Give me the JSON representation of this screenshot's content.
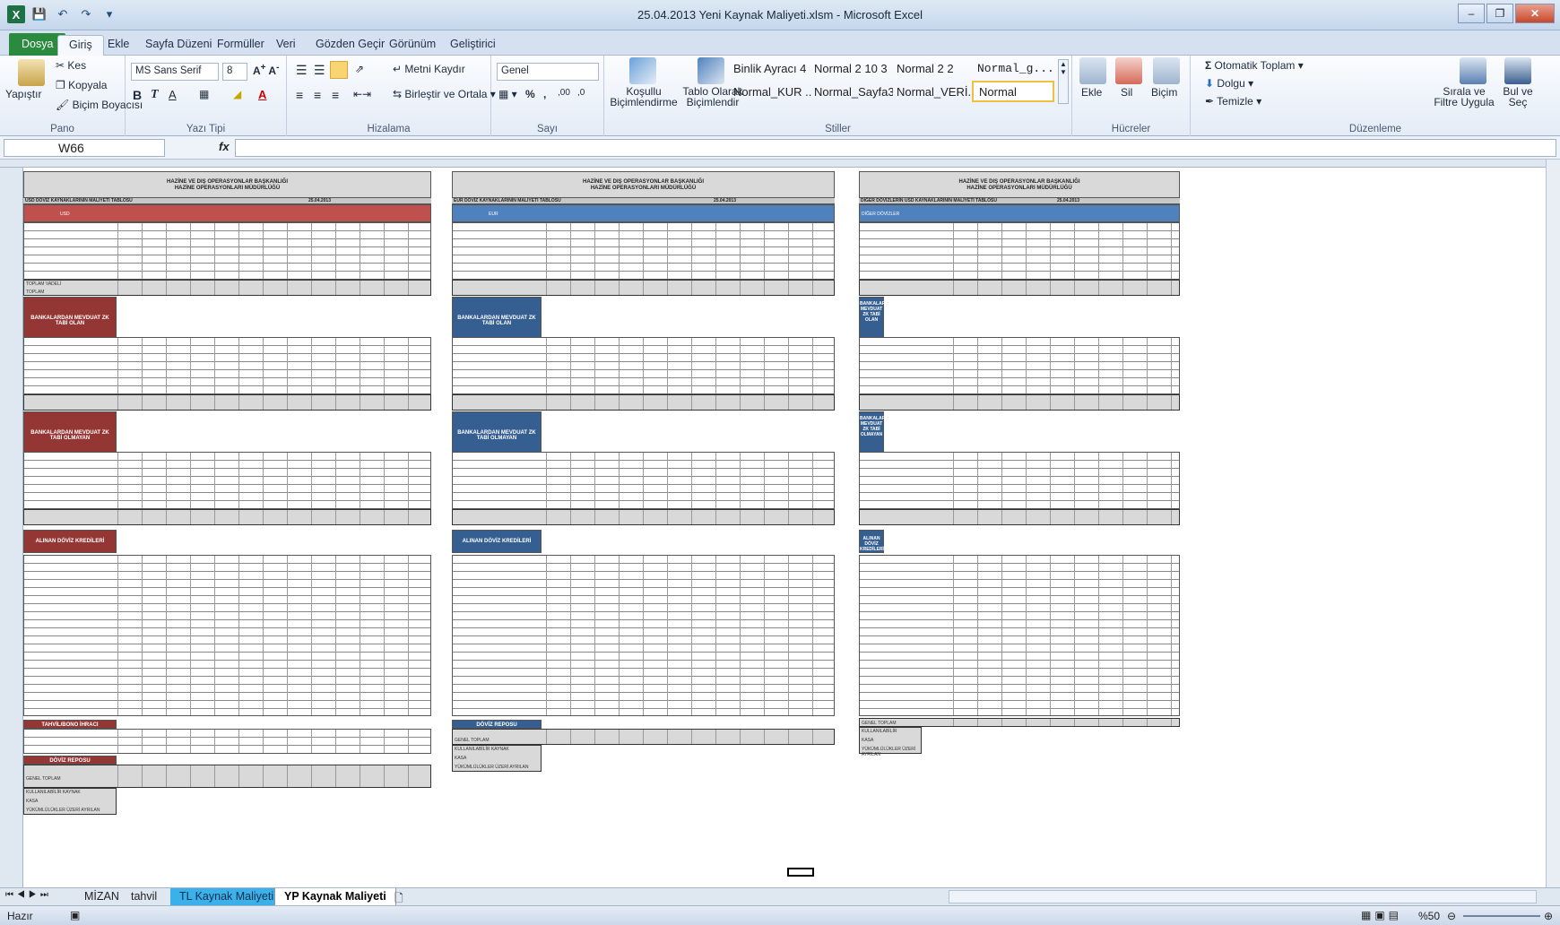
{
  "window": {
    "title": "25.04.2013 Yeni Kaynak Maliyeti.xlsm - Microsoft Excel"
  },
  "ribbon_tabs": [
    "Dosya",
    "Giriş",
    "Ekle",
    "Sayfa Düzeni",
    "Formüller",
    "Veri",
    "Gözden Geçir",
    "Görünüm",
    "Geliştirici"
  ],
  "ribbon": {
    "pano": {
      "paste": "Yapıştır",
      "cut": "Kes",
      "copy": "Kopyala",
      "format_painter": "Biçim Boyacısı",
      "label": "Pano"
    },
    "font": {
      "name": "MS Sans Serif",
      "size": "8",
      "label": "Yazı Tipi"
    },
    "alignment": {
      "wrap": "Metni Kaydır",
      "merge": "Birleştir ve Ortala",
      "label": "Hizalama"
    },
    "number": {
      "format": "Genel",
      "label": "Sayı"
    },
    "styles": {
      "conditional": "Koşullu Biçimlendirme",
      "as_table": "Tablo Olarak Biçimlendir",
      "cells": [
        "Binlik Ayracı 4",
        "Normal 2 10 3",
        "Normal 2 2",
        "Normal_g...",
        "Normal_KUR ...",
        "Normal_Sayfa3",
        "Normal_VERİ...",
        "Normal"
      ],
      "label": "Stiller"
    },
    "cells": {
      "insert": "Ekle",
      "delete": "Sil",
      "format": "Biçim",
      "label": "Hücreler"
    },
    "editing": {
      "autosum": "Otomatik Toplam",
      "fill": "Dolgu",
      "clear": "Temizle",
      "sort": "Sırala ve Filtre Uygula",
      "find": "Bul ve Seç",
      "label": "Düzenleme"
    }
  },
  "formula_bar": {
    "name_box": "W66",
    "fx": "fx",
    "formula": ""
  },
  "sheet": {
    "blocks": [
      {
        "title": "HAZİNE VE DIŞ OPERASYONLAR BAŞKANLIĞI\nHAZİNE OPERASYONLARI MÜDÜRLÜĞÜ",
        "subtitle": "USD DÖVİZ KAYNAKLARININ MALİYETİ TABLOSU",
        "date": "25.04.2013",
        "currency": "USD",
        "sec1": "BANKALARDAN MEVDUAT ZK TABİ OLAN",
        "sec2": "BANKALARDAN MEVDUAT ZK TABİ OLMAYAN",
        "sec3": "ALINAN DÖVİZ KREDİLERİ",
        "sec4": "TAHVİL/BONO İHRACI",
        "sec5": "DÖVİZ REPOSU",
        "tot1": "TOPLAM VADELİ",
        "tot2": "TOPLAM",
        "total": "GENEL TOPLAM",
        "usable": "KULLANILABİLİR KAYNAK",
        "kasa": "KASA",
        "reserve": "YÜKÜMLÜLÜKLER ÜZERİ AYRILAN"
      },
      {
        "title": "HAZİNE VE DIŞ OPERASYONLAR BAŞKANLIĞI\nHAZİNE OPERASYONLARI MÜDÜRLÜĞÜ",
        "subtitle": "EUR DÖVİZ KAYNAKLARININ MALİYETİ TABLOSU",
        "date": "25.04.2013",
        "currency": "EUR",
        "sec1": "BANKALARDAN MEVDUAT ZK TABİ OLAN",
        "sec2": "BANKALARDAN MEVDUAT ZK TABİ OLMAYAN",
        "sec3": "ALINAN DÖVİZ KREDİLERİ",
        "sec5": "DÖVİZ REPOSU",
        "total": "GENEL TOPLAM",
        "usable": "KULLANILABİLİR KAYNAK",
        "kasa": "KASA",
        "reserve": "YÜKÜMLÜLÜKLER ÜZERİ AYRILAN"
      },
      {
        "title": "HAZİNE VE DIŞ OPERASYONLAR BAŞKANLIĞI\nHAZİNE OPERASYONLARI MÜDÜRLÜĞÜ",
        "subtitle": "DİĞER DÖVİZLERİN USD KAYNAKLARININ MALİYETİ TABLOSU",
        "date": "25.04.2013",
        "currency": "DİĞER DÖVİZLER",
        "sec1": "BANKALAR MEVDUAT ZK TABİ OLAN",
        "sec2": "BANKALAR MEVDUAT ZK TABİ OLMAYAN",
        "sec3": "ALINAN DÖVİZ KREDİLERİ",
        "total": "GENEL TOPLAM",
        "usable": "KULLANILABİLİR",
        "kasa": "KASA",
        "reserve": "YÜKÜMLÜLÜKLER ÜZERİ AYRILAN"
      }
    ]
  },
  "sheet_tabs": [
    "MİZAN",
    "tahvil",
    "TL Kaynak Maliyeti",
    "YP Kaynak Maliyeti"
  ],
  "status": {
    "ready": "Hazır",
    "zoom": "%50"
  }
}
